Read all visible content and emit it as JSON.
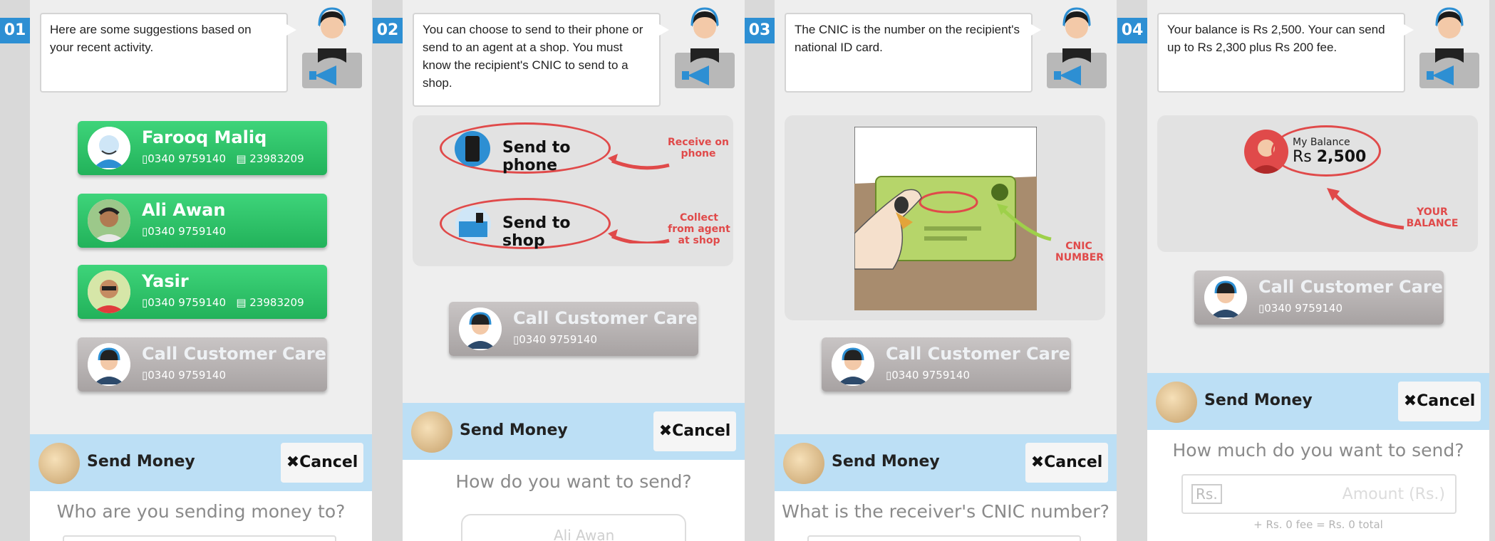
{
  "panels": [
    {
      "number": "01",
      "bubble": "Here are some suggestions based on your recent activity.",
      "contacts": [
        {
          "name": "Farooq Maliq",
          "phone": "▯0340 9759140",
          "id": "▤ 23983209"
        },
        {
          "name": "Ali Awan",
          "phone": "▯0340 9759140"
        },
        {
          "name": "Yasir",
          "phone": "▯0340 9759140",
          "id": "▤ 23983209"
        }
      ],
      "customer_care": {
        "label": "Call Customer Care",
        "phone": "▯0340 9759140"
      },
      "send_money": {
        "title": "Send Money",
        "cancel": "✖Cancel",
        "question": "Who are you sending money to?"
      }
    },
    {
      "number": "02",
      "bubble": "You can choose to send to their phone or send to an agent at a shop. You must know the recipient's CNIC to send to a shop.",
      "options": [
        {
          "label": "Send to phone",
          "annotation": "Receive on phone"
        },
        {
          "label": "Send to shop",
          "annotation": "Collect from agent at shop"
        }
      ],
      "customer_care": {
        "label": "Call Customer Care",
        "phone": "▯0340 9759140"
      },
      "send_money": {
        "title": "Send Money",
        "cancel": "✖Cancel",
        "question": "How do you want to send?",
        "partial_contact": "Ali Awan"
      }
    },
    {
      "number": "03",
      "bubble": "The CNIC is the number on the recipient's national ID card.",
      "annotation": "CNIC NUMBER",
      "customer_care": {
        "label": "Call Customer Care",
        "phone": "▯0340 9759140"
      },
      "send_money": {
        "title": "Send Money",
        "cancel": "✖Cancel",
        "question": "What is the receiver's CNIC number?"
      }
    },
    {
      "number": "04",
      "bubble": "Your balance is Rs 2,500. Your can send up to Rs 2,300 plus Rs 200 fee.",
      "balance": {
        "label": "My Balance",
        "currency": "Rs",
        "amount": "2,500"
      },
      "annotation": "YOUR BALANCE",
      "customer_care": {
        "label": "Call Customer Care",
        "phone": "▯0340 9759140"
      },
      "send_money": {
        "title": "Send Money",
        "cancel": "✖Cancel",
        "question": "How much do you want to send?",
        "currency_prefix": "Rs.",
        "amount_placeholder": "Amount (Rs.)",
        "fee_line": "+ Rs. 0 fee = Rs. 0 total"
      }
    }
  ],
  "colors": {
    "step_badge": "#2d8fd3",
    "green": "#2ecb6c",
    "accent_red": "#e04a4a",
    "send_bar": "#bcdff5"
  }
}
